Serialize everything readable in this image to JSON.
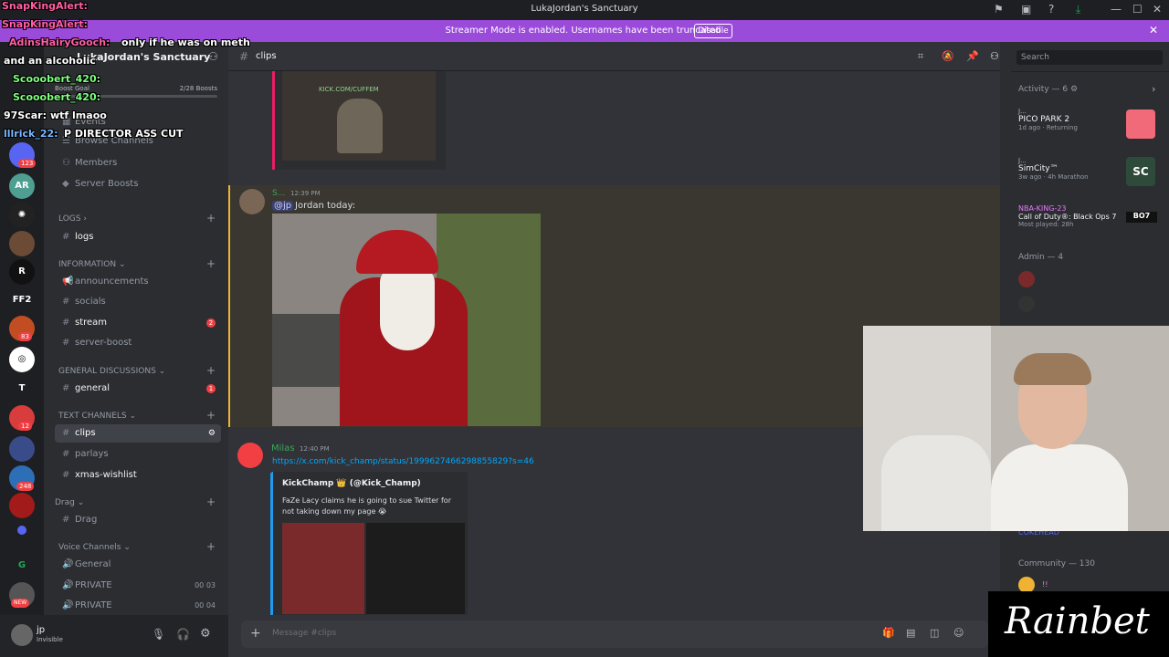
{
  "window": {
    "title": "LukaJordan's Sanctuary"
  },
  "banner": {
    "text": "Streamer Mode is enabled. Usernames have been truncated.",
    "button": "Disable"
  },
  "rail": {
    "badges": [
      "123",
      "83",
      "12",
      "248"
    ],
    "labels": [
      "FF2",
      "T"
    ],
    "new_label": "NEW"
  },
  "server": {
    "name": "LukaJordan's Sanctuary",
    "boost_label": "Boost Goal",
    "boosts": "2/28 Boosts",
    "events": "Events"
  },
  "sidebar": {
    "browse": "Browse Channels",
    "members": "Members",
    "server_boosts": "Server Boosts",
    "categories": {
      "logs": "LOGS",
      "information": "INFORMATION",
      "general": "GENERAL DISCUSSIONS",
      "text": "TEXT CHANNELS",
      "drag": "Drag",
      "voice": "Voice Channels"
    },
    "channels": {
      "logs": "logs",
      "announcements": "announcements",
      "socials": "socials",
      "stream": "stream",
      "stream_badge": "2",
      "server_boost": "server-boost",
      "general": "general",
      "general_badge": "1",
      "clips": "clips",
      "parlays": "parlays",
      "xmas": "xmas-wishlist",
      "drag": "Drag",
      "voice_general": "General",
      "private1": "PRIVATE",
      "private1_counts": "00 03",
      "private2": "PRIVATE",
      "private2_counts": "00 04"
    }
  },
  "user": {
    "name": "jp",
    "status": "Invisible"
  },
  "chat": {
    "channel": "clips",
    "embed1_label": "KICK.COM/CUFFEM",
    "msg1": {
      "author": "S...",
      "time": "12:39 PM",
      "mention": "@jp",
      "text": "Jordan today:"
    },
    "msg2": {
      "author": "Milas",
      "time": "12:40 PM",
      "link": "https://x.com/kick_champ/status/1999627466298855829?s=46"
    },
    "embed2": {
      "author": "KickChamp 👑 (@Kick_Champ)",
      "text": "FaZe Lacy claims he is going to sue Twitter for not taking down my page 😭"
    }
  },
  "composer": {
    "placeholder": "Message #clips"
  },
  "search": {
    "placeholder": "Search"
  },
  "activity": {
    "header": "Activity — 6",
    "items": [
      {
        "user": "J...",
        "game": "PICO PARK 2",
        "meta": "1d ago",
        "tag": "Returning"
      },
      {
        "user": "J...",
        "game": "SimCity™",
        "meta": "3w ago",
        "tag": "4h Marathon"
      },
      {
        "user": "NBA-KING-23",
        "game": "Call of Duty®: Black Ops 7",
        "meta": "Most played: 28h",
        "tag": ""
      }
    ]
  },
  "members": {
    "admin": "Admin — 4",
    "community": "Community — 130",
    "name_partial": "COKEHEAD",
    "community_first": "!!"
  },
  "overlay_chat": [
    {
      "user": "SnapKingAlert:",
      "text": ""
    },
    {
      "user": "SnapKingAlert:",
      "text": ""
    },
    {
      "user": "AdinsHairyGooch:",
      "text": "only if he was on meth"
    },
    {
      "user": "",
      "text": "and an alcoholic"
    },
    {
      "user": "Scooobert_420:",
      "text": ""
    },
    {
      "user": "Scooobert_420:",
      "text": ""
    },
    {
      "user": "97Scar:",
      "text": "wtf lmaoo"
    },
    {
      "user": "lllrick_22:",
      "text": "P DIRECTOR ASS CUT"
    }
  ],
  "rainbet": {
    "logo": "Rainbet"
  },
  "colors": {
    "accent": "#5865f2",
    "banner": "#9b4bd9",
    "mention": "#3ba55c",
    "link": "#00a8fc",
    "badge": "#f23f43"
  }
}
